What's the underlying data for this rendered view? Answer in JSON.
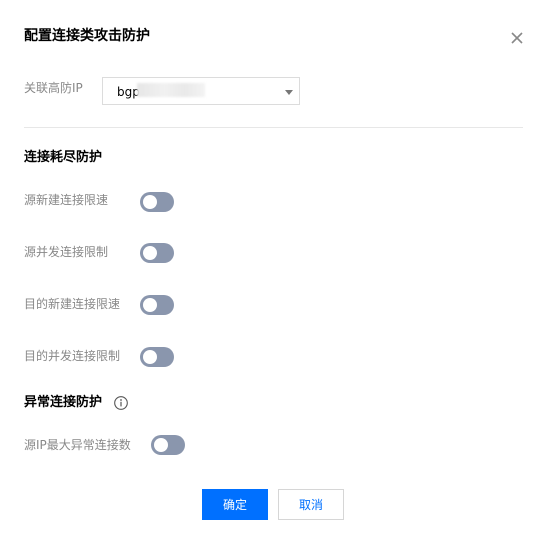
{
  "dialog": {
    "title": "配置连接类攻击防护",
    "close_icon": "close-icon"
  },
  "ip_field": {
    "label": "关联高防IP",
    "value": "bgp",
    "dropdown_icon": "caret-down-icon"
  },
  "section_exhaustion": {
    "title": "连接耗尽防护",
    "items": [
      {
        "label": "源新建连接限速",
        "enabled": false
      },
      {
        "label": "源并发连接限制",
        "enabled": false
      },
      {
        "label": "目的新建连接限速",
        "enabled": false
      },
      {
        "label": "目的并发连接限制",
        "enabled": false
      }
    ]
  },
  "section_abnormal": {
    "title": "异常连接防护",
    "info_icon": "info-icon",
    "items": [
      {
        "label": "源IP最大异常连接数",
        "enabled": false
      }
    ]
  },
  "footer": {
    "confirm_label": "确定",
    "cancel_label": "取消"
  },
  "colors": {
    "primary": "#0070ff",
    "toggle_off": "#8a96ad",
    "label_gray": "#888888"
  }
}
